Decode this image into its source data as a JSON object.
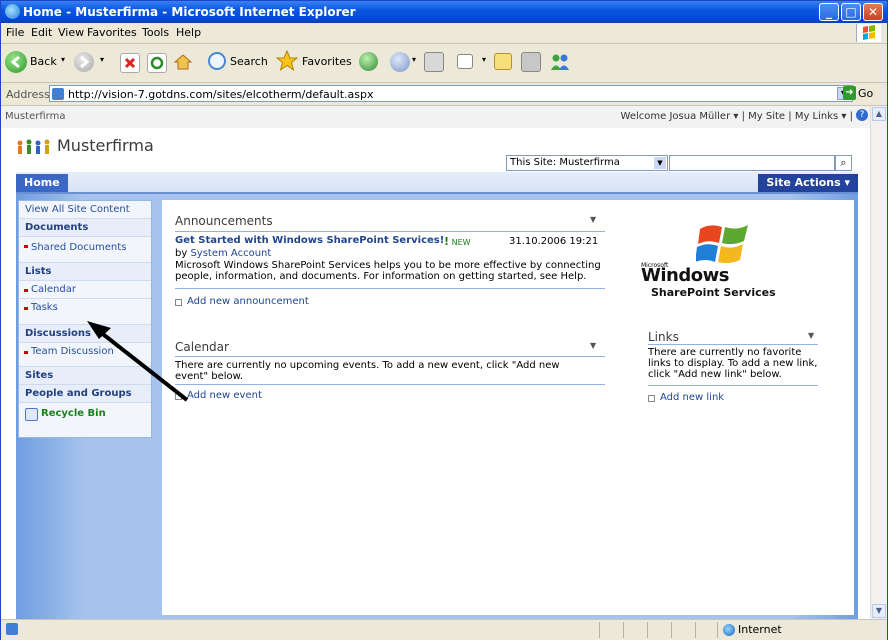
{
  "window": {
    "title": "Home - Musterfirma - Microsoft Internet Explorer"
  },
  "menu": [
    "File",
    "Edit",
    "View",
    "Favorites",
    "Tools",
    "Help"
  ],
  "toolbar": {
    "back_label": "Back",
    "search_label": "Search",
    "favorites_label": "Favorites"
  },
  "address": {
    "label": "Address",
    "url": "http://vision-7.gotdns.com/sites/elcotherm/default.aspx",
    "go_label": "Go"
  },
  "sp": {
    "breadcrumb": "Musterfirma",
    "welcome": "Welcome Josua Müller ▾",
    "my_site": "My Site",
    "my_links": "My Links ▾",
    "site_title": "Musterfirma",
    "search_scope": "This Site: Musterfirma",
    "home_tab": "Home",
    "site_actions": "Site Actions ▾"
  },
  "quicklaunch": {
    "view_all": "View All Site Content",
    "documents": "Documents",
    "shared_documents": "Shared Documents",
    "lists": "Lists",
    "calendar": "Calendar",
    "tasks": "Tasks",
    "discussions": "Discussions",
    "team_discussion": "Team Discussion",
    "sites": "Sites",
    "people_groups": "People and Groups",
    "recycle_bin": "Recycle Bin"
  },
  "announcements": {
    "title": "Announcements",
    "item_title": "Get Started with Windows SharePoint Services!",
    "item_badge": "NEW",
    "item_date": "31.10.2006 19:21",
    "item_by_prefix": "by",
    "item_author": "System Account",
    "item_body": "Microsoft Windows SharePoint Services helps you to be more effective by connecting people, information, and documents. For information on getting started, see Help.",
    "add_link": "Add new announcement"
  },
  "calendar": {
    "title": "Calendar",
    "empty_text": "There are currently no upcoming events. To add a new event, click \"Add new event\" below.",
    "add_link": "Add new event"
  },
  "links": {
    "title": "Links",
    "empty_text": "There are currently no favorite links to display. To add a new link, click \"Add new link\" below.",
    "add_link": "Add new link"
  },
  "logo": {
    "microsoft": "Microsoft",
    "windows": "Windows",
    "sps": "SharePoint Services"
  },
  "status": {
    "zone": "Internet"
  }
}
